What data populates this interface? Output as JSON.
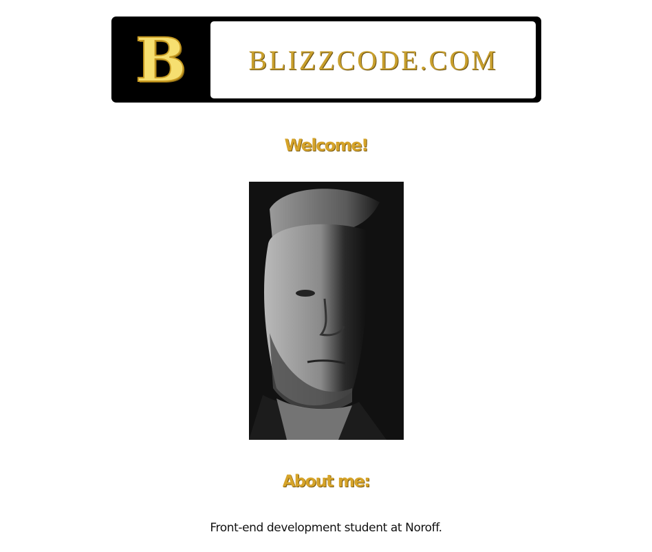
{
  "header": {
    "logo_letter": "B",
    "site_name": "BLIZZCODE.COM"
  },
  "main": {
    "welcome_heading": "Welcome!",
    "about_heading": "About me:",
    "about_text": "Front-end development student at Noroff."
  },
  "colors": {
    "accent": "#d6a42a",
    "banner_bg": "#000000",
    "text": "#111111"
  }
}
